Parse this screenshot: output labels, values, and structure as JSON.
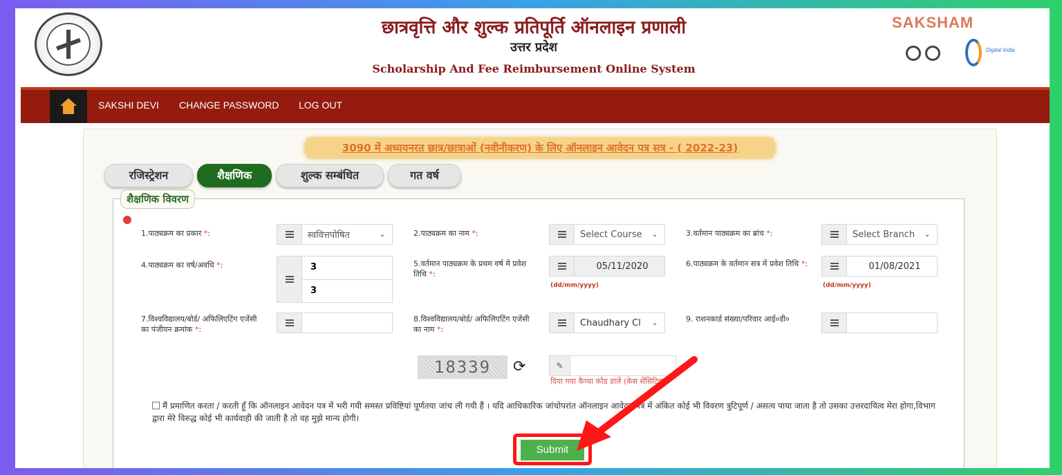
{
  "header": {
    "title_hindi": "छात्रवृत्ति और शुल्क प्रतिपूर्ति ऑनलाइन प्रणाली",
    "state": "उत्तर प्रदेश",
    "title_english": "Scholarship And Fee Reimbursement Online System",
    "brand": "SAKSHAM",
    "digital_india": "Digital India"
  },
  "nav": {
    "items": [
      {
        "label": "SAKSHI DEVI"
      },
      {
        "label": "CHANGE PASSWORD"
      },
      {
        "label": "LOG OUT"
      }
    ]
  },
  "banner": "3090 में अध्ययनरत छात्र/छात्राओं (नवीनीकरण) के लिए ऑनलाइन आवेदन पत्र सत्र - ( 2022-23)",
  "tabs": [
    {
      "label": "रजिस्ट्रेशन"
    },
    {
      "label": "शैक्षणिक"
    },
    {
      "label": "शुल्क सम्बंधित"
    },
    {
      "label": "गत वर्ष"
    }
  ],
  "section_legend": "शैक्षणिक विवरण",
  "fields": {
    "f1": {
      "label": "1.पाठ्यक्रम का प्रकार",
      "value": "स्ववित्तपोषित"
    },
    "f2": {
      "label": "2.पाठ्यक्रम का नाम",
      "value": "Select Course"
    },
    "f3": {
      "label": "3.वर्तमान पाठ्यक्रम का ब्रांच",
      "value": "Select Branch"
    },
    "f4": {
      "label": "4.पाठ्यक्रम का वर्ष/अवधि",
      "value1": "3",
      "value2": "3"
    },
    "f5": {
      "label": "5.वर्तमान पाठ्यक्रम के प्रथम वर्ष में प्रवेश तिथि",
      "value": "05/11/2020",
      "hint": "(dd/mm/yyyy)"
    },
    "f6": {
      "label": "6.पाठ्यक्रम के वर्तमान सत्र में प्रवेश तिथि",
      "value": "01/08/2021",
      "hint": "(dd/mm/yyyy)"
    },
    "f7": {
      "label": "7.विश्वविद्यालय/बोर्ड/ अफिलिएटिंग एजेंसी का पंजीयन क्रमांक",
      "value": ""
    },
    "f8": {
      "label": "8.विश्वविद्यालय/बोर्ड/ अफिलिएटिंग एजेंसी का नाम",
      "value": "Chaudhary Cl"
    },
    "f9": {
      "label": "9. राशनकार्ड संख्या/परिवार आई०डी०",
      "value": ""
    }
  },
  "captcha": {
    "code": "18339",
    "hint": "दिया गया कैप्चा कोड डालें (केस सेंसिटिव)*",
    "value": ""
  },
  "declaration": "मैं प्रमाणित करता / करती हूँ कि ऑनलाइन आवेदन पत्र में भरी गयी समस्त प्रविष्टियां पूर्णतया जांच ली गयी हैं । यदि आधिकारिक जांचोपरांत ऑनलाइन आवेदन पत्र में अंकित कोई भी विवरण त्रुटिपूर्ण / असत्य पाया जाता है तो उसका उत्तरदायित्व मेरा होगा,विभाग द्वारा मेरे विरुद्ध कोई भी कार्यवाही की जाती है तो वह मुझे मान्य होगी।",
  "submit_label": "Submit",
  "colors": {
    "nav_bg": "#951b0f",
    "active_tab": "#1f6b1f",
    "submit": "#4cb04c",
    "highlight": "#ff1616"
  }
}
